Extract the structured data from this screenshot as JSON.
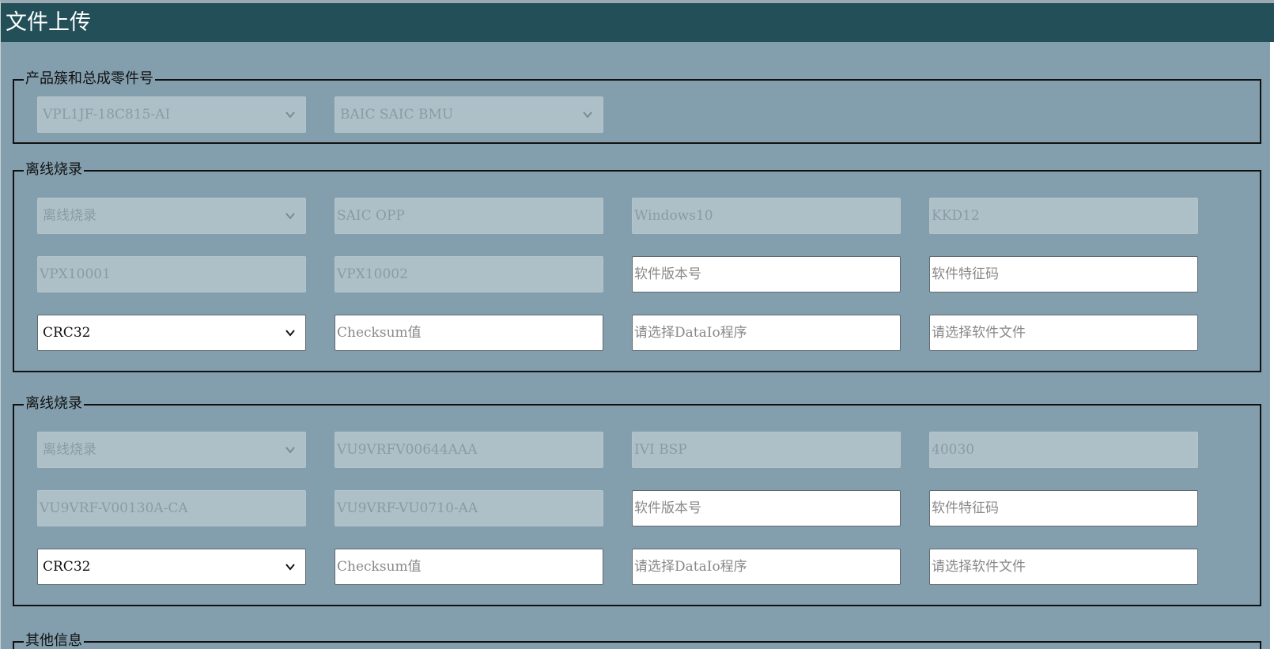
{
  "window": {
    "title": "文件上传"
  },
  "groups": [
    {
      "legend": "产品簇和总成零件号",
      "fields": [
        {
          "value": "VPL1JF-18C815-AI",
          "type": "select",
          "state": "disabled"
        },
        {
          "value": "BAIC SAIC BMU",
          "type": "select",
          "state": "disabled"
        }
      ]
    },
    {
      "legend": "离线烧录",
      "rows": [
        [
          {
            "value": "离线烧录",
            "type": "select",
            "state": "disabled"
          },
          {
            "value": "SAIC OPP",
            "type": "text",
            "state": "disabled"
          },
          {
            "value": "Windows10",
            "type": "text",
            "state": "disabled"
          },
          {
            "value": "KKD12",
            "type": "text",
            "state": "disabled"
          }
        ],
        [
          {
            "value": "VPX10001",
            "type": "text",
            "state": "disabled"
          },
          {
            "value": "VPX10002",
            "type": "text",
            "state": "disabled"
          },
          {
            "placeholder": "软件版本号",
            "type": "text",
            "state": "active"
          },
          {
            "placeholder": "软件特征码",
            "type": "text",
            "state": "active"
          }
        ],
        [
          {
            "value": "CRC32",
            "type": "select",
            "state": "active"
          },
          {
            "placeholder": "Checksum值",
            "type": "text",
            "state": "active"
          },
          {
            "placeholder": "请选择DataIo程序",
            "type": "file",
            "state": "active"
          },
          {
            "placeholder": "请选择软件文件",
            "type": "file",
            "state": "active"
          }
        ]
      ]
    },
    {
      "legend": "离线烧录",
      "rows": [
        [
          {
            "value": "离线烧录",
            "type": "select",
            "state": "disabled"
          },
          {
            "value": "VU9VRFV00644AAA",
            "type": "text",
            "state": "disabled"
          },
          {
            "value": "IVI BSP",
            "type": "text",
            "state": "disabled"
          },
          {
            "value": "40030",
            "type": "text",
            "state": "disabled"
          }
        ],
        [
          {
            "value": "VU9VRF-V00130A-CA",
            "type": "text",
            "state": "disabled"
          },
          {
            "value": "VU9VRF-VU0710-AA",
            "type": "text",
            "state": "disabled"
          },
          {
            "placeholder": "软件版本号",
            "type": "text",
            "state": "active"
          },
          {
            "placeholder": "软件特征码",
            "type": "text",
            "state": "active"
          }
        ],
        [
          {
            "value": "CRC32",
            "type": "select",
            "state": "active"
          },
          {
            "placeholder": "Checksum值",
            "type": "text",
            "state": "active"
          },
          {
            "placeholder": "请选择DataIo程序",
            "type": "file",
            "state": "active"
          },
          {
            "placeholder": "请选择软件文件",
            "type": "file",
            "state": "active"
          }
        ]
      ]
    },
    {
      "legend": "其他信息"
    }
  ],
  "icons": {
    "dropdown": "chevron-down-icon"
  },
  "colors": {
    "titlebar": "#234f59",
    "background": "#839ead",
    "disabled_field": "#adc0c8",
    "active_field": "#ffffff"
  }
}
